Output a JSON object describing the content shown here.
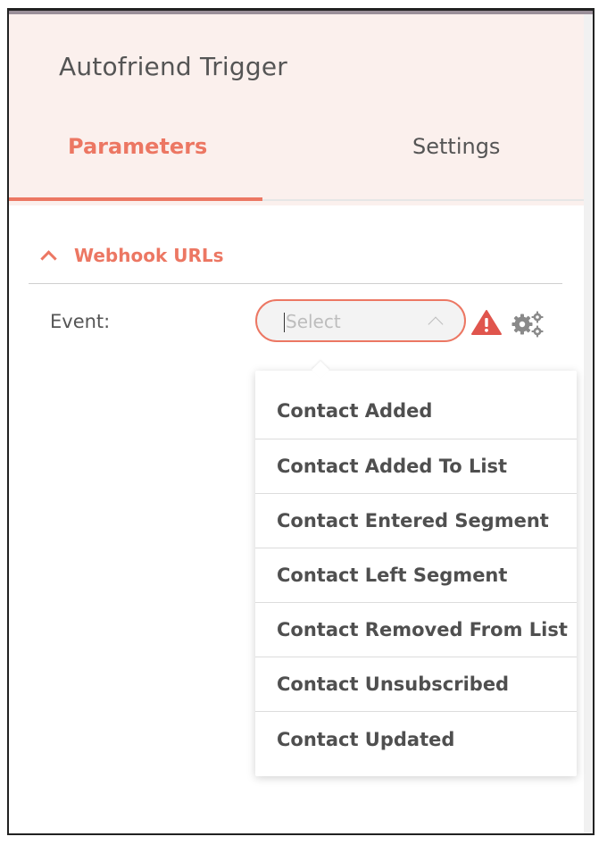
{
  "panel": {
    "title": "Autofriend Trigger",
    "tabs": [
      {
        "label": "Parameters",
        "active": true
      },
      {
        "label": "Settings",
        "active": false
      }
    ]
  },
  "section": {
    "label": "Webhook URLs",
    "expanded": true
  },
  "event_field": {
    "label": "Event:",
    "placeholder": "Select",
    "options": [
      "Contact Added",
      "Contact Added To List",
      "Contact Entered Segment",
      "Contact Left Segment",
      "Contact Removed From List",
      "Contact Unsubscribed",
      "Contact Updated"
    ]
  },
  "icons": {
    "warning": "warning-icon",
    "settings": "gears-icon"
  },
  "colors": {
    "accent": "#ec7763",
    "header_bg": "#fbf0ed",
    "warning": "#e0554d",
    "gear": "#8a8a8a"
  }
}
